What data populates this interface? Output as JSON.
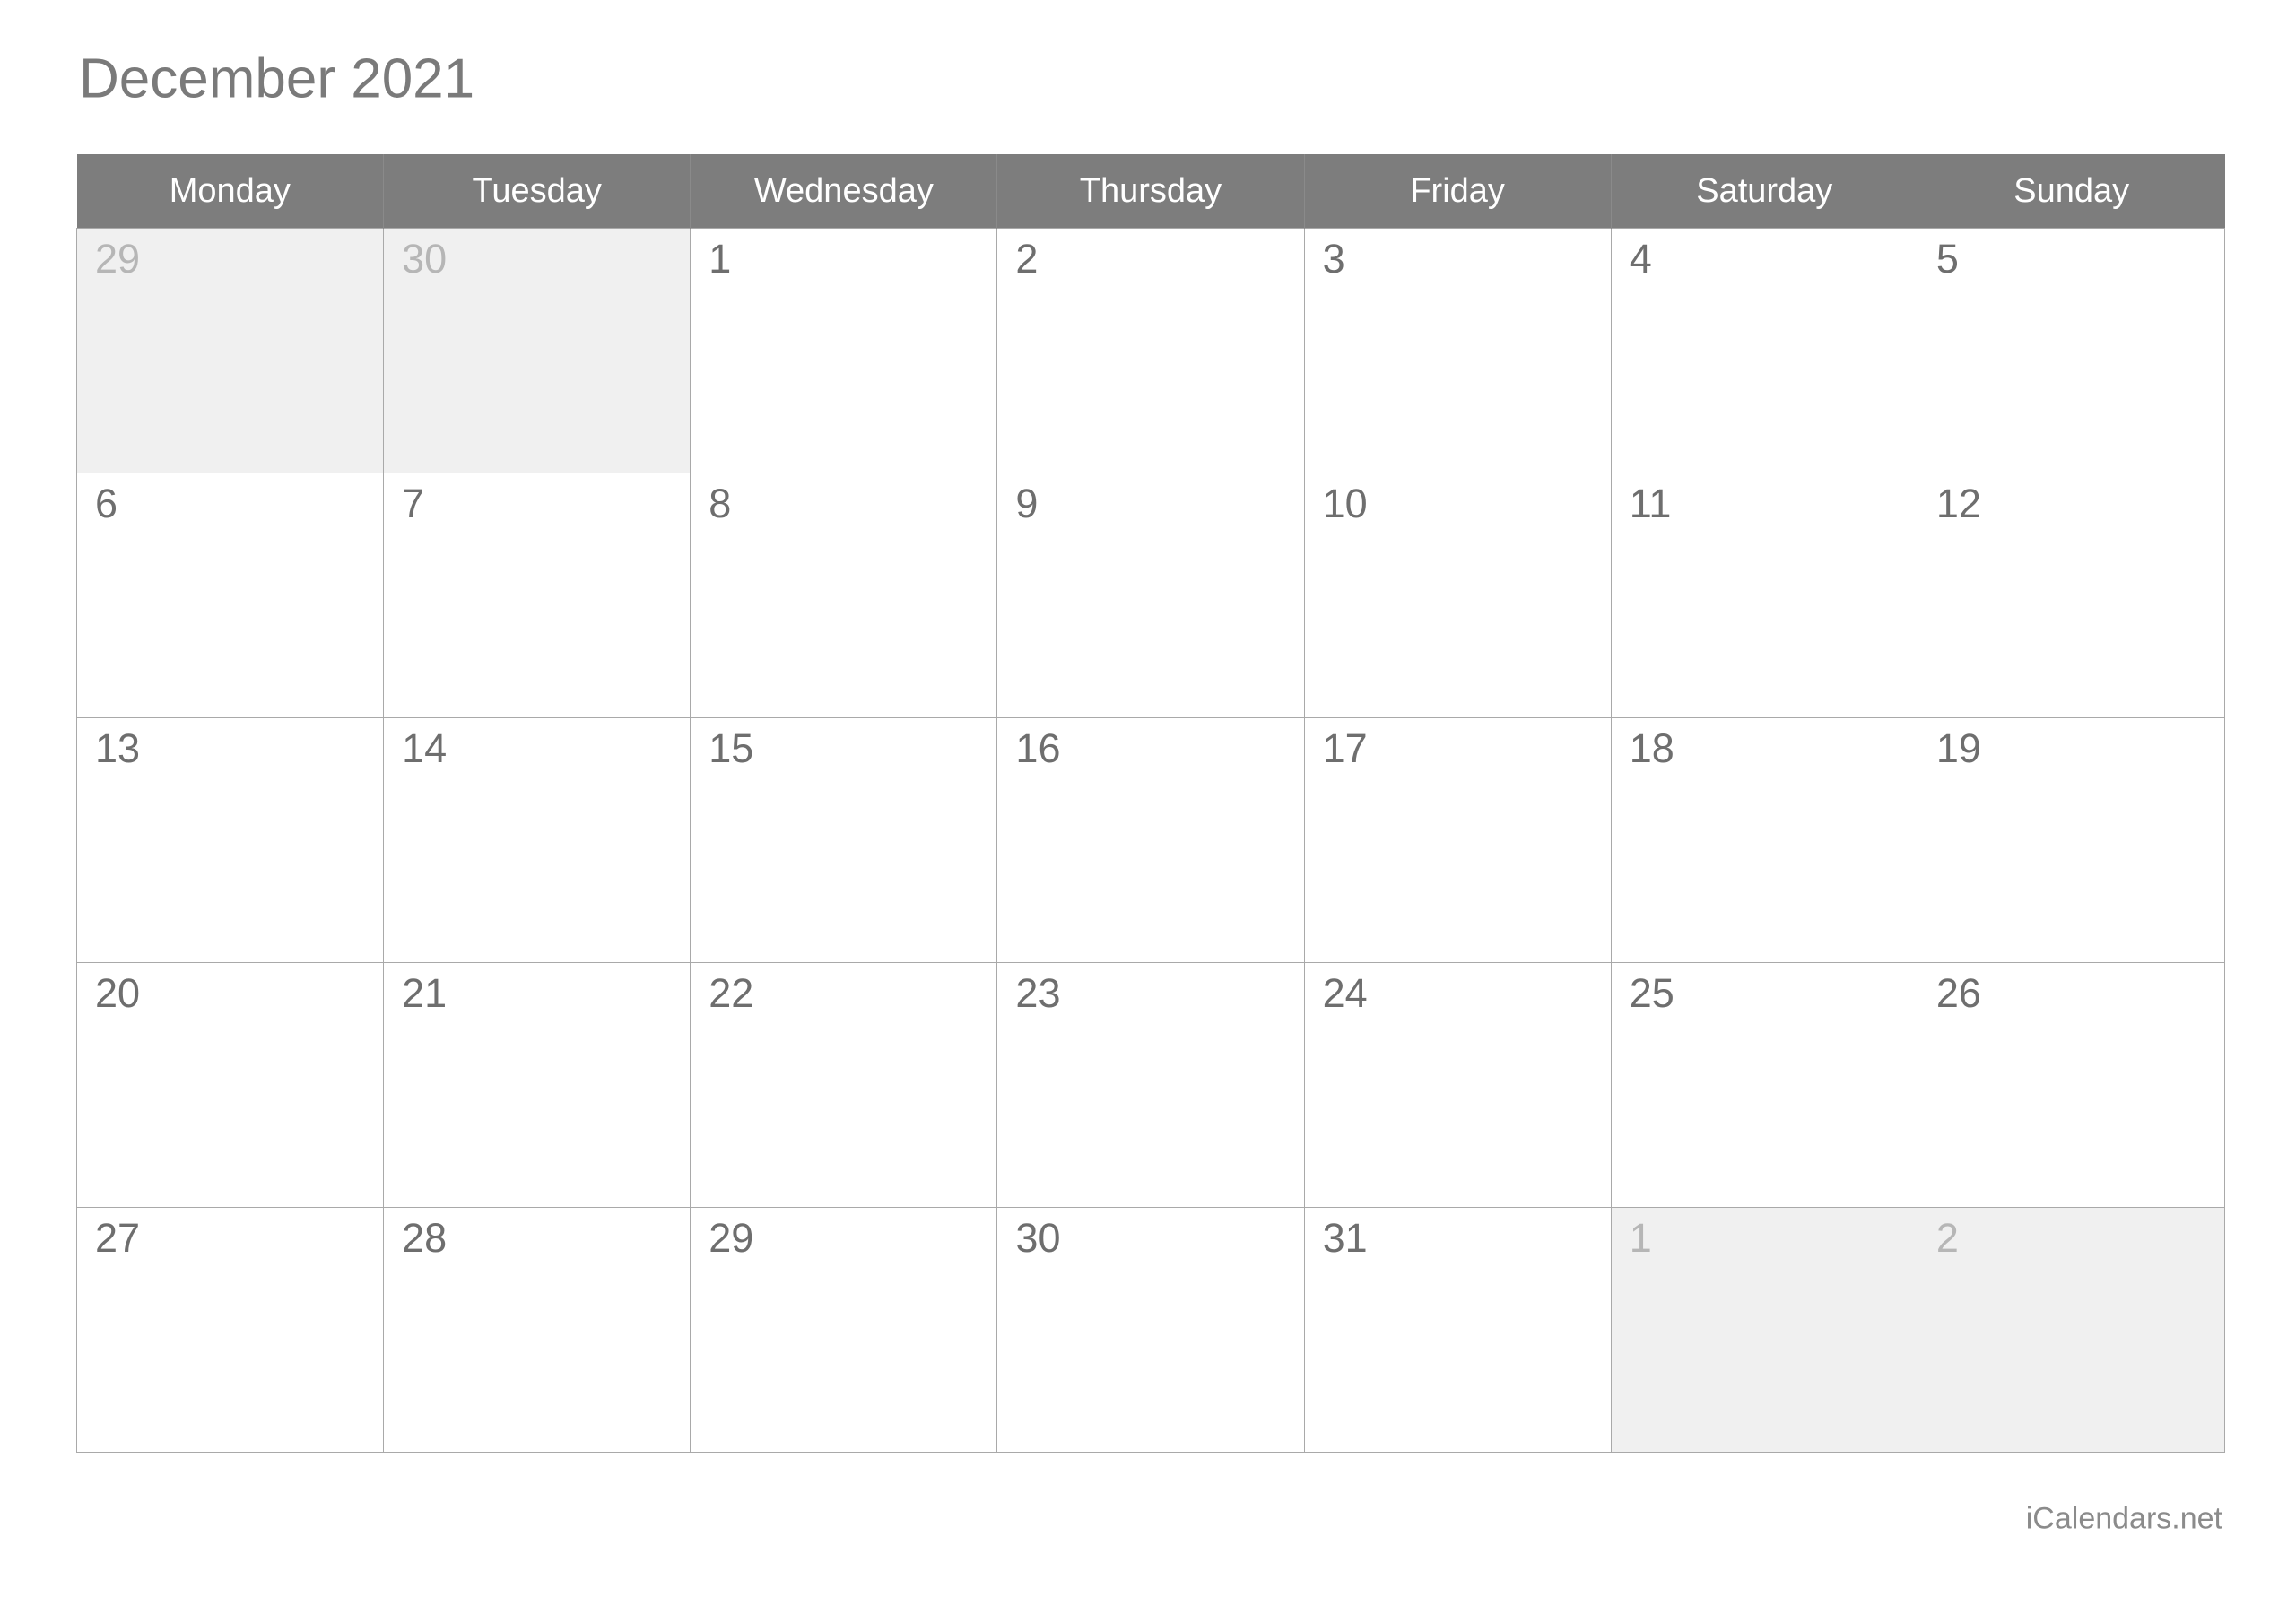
{
  "document": {
    "title": "December 2021",
    "watermark": "iCalendars.net"
  },
  "colors": {
    "header_band": "#7d7d7d",
    "title_text": "#7a7a7a",
    "day_number": "#6e6e6e",
    "muted_day_number": "#b6b6b6",
    "muted_cell_background": "#f0f0f0",
    "grid_border": "#a9a9a9",
    "header_text": "#ffffff",
    "page_background": "#ffffff"
  },
  "calendar": {
    "month": "December",
    "year": "2021",
    "week_start": "Monday",
    "weekday_headers": [
      "Monday",
      "Tuesday",
      "Wednesday",
      "Thursday",
      "Friday",
      "Saturday",
      "Sunday"
    ],
    "weeks": [
      {
        "days": [
          {
            "label": "29",
            "muted": true
          },
          {
            "label": "30",
            "muted": true
          },
          {
            "label": "1",
            "muted": false
          },
          {
            "label": "2",
            "muted": false
          },
          {
            "label": "3",
            "muted": false
          },
          {
            "label": "4",
            "muted": false
          },
          {
            "label": "5",
            "muted": false
          }
        ]
      },
      {
        "days": [
          {
            "label": "6",
            "muted": false
          },
          {
            "label": "7",
            "muted": false
          },
          {
            "label": "8",
            "muted": false
          },
          {
            "label": "9",
            "muted": false
          },
          {
            "label": "10",
            "muted": false
          },
          {
            "label": "11",
            "muted": false
          },
          {
            "label": "12",
            "muted": false
          }
        ]
      },
      {
        "days": [
          {
            "label": "13",
            "muted": false
          },
          {
            "label": "14",
            "muted": false
          },
          {
            "label": "15",
            "muted": false
          },
          {
            "label": "16",
            "muted": false
          },
          {
            "label": "17",
            "muted": false
          },
          {
            "label": "18",
            "muted": false
          },
          {
            "label": "19",
            "muted": false
          }
        ]
      },
      {
        "days": [
          {
            "label": "20",
            "muted": false
          },
          {
            "label": "21",
            "muted": false
          },
          {
            "label": "22",
            "muted": false
          },
          {
            "label": "23",
            "muted": false
          },
          {
            "label": "24",
            "muted": false
          },
          {
            "label": "25",
            "muted": false
          },
          {
            "label": "26",
            "muted": false
          }
        ]
      },
      {
        "days": [
          {
            "label": "27",
            "muted": false
          },
          {
            "label": "28",
            "muted": false
          },
          {
            "label": "29",
            "muted": false
          },
          {
            "label": "30",
            "muted": false
          },
          {
            "label": "31",
            "muted": false
          },
          {
            "label": "1",
            "muted": true
          },
          {
            "label": "2",
            "muted": true
          }
        ]
      }
    ]
  }
}
